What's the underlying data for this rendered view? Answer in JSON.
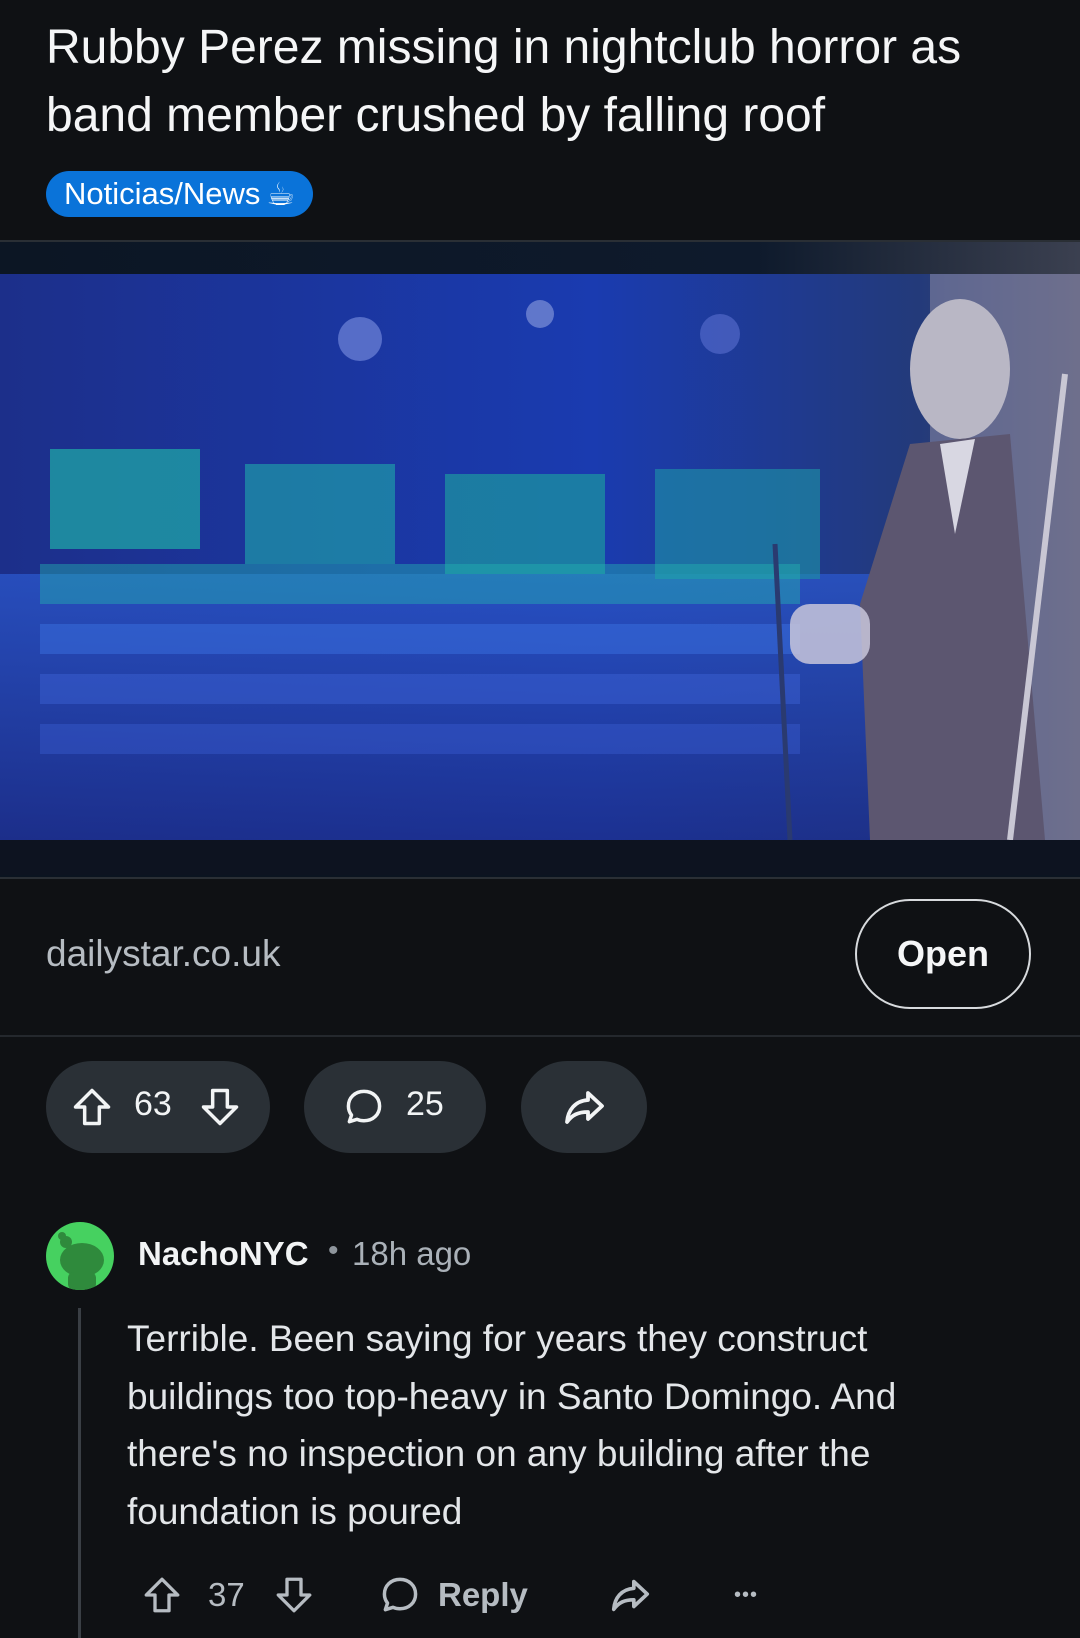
{
  "post": {
    "title": "Rubby Perez missing in nightclub horror as band member crushed by falling roof",
    "flair": "Noticias/News",
    "flair_emoji": "☕",
    "link_domain": "dailystar.co.uk",
    "open_label": "Open",
    "upvotes": "63",
    "comments": "25"
  },
  "comment": {
    "author": "NachoNYC",
    "separator": "•",
    "age": "18h ago",
    "body": "Terrible. Been saying for years they construct buildings too top-heavy in Santo Domingo. And there's no inspection on any building after the foundation is poured",
    "upvotes": "37",
    "reply_label": "Reply",
    "more": "•••"
  },
  "colors": {
    "background": "#0f1114",
    "flair_bg": "#0a73d9",
    "pill_bg": "#2a3036",
    "avatar_bg": "#46d160"
  }
}
